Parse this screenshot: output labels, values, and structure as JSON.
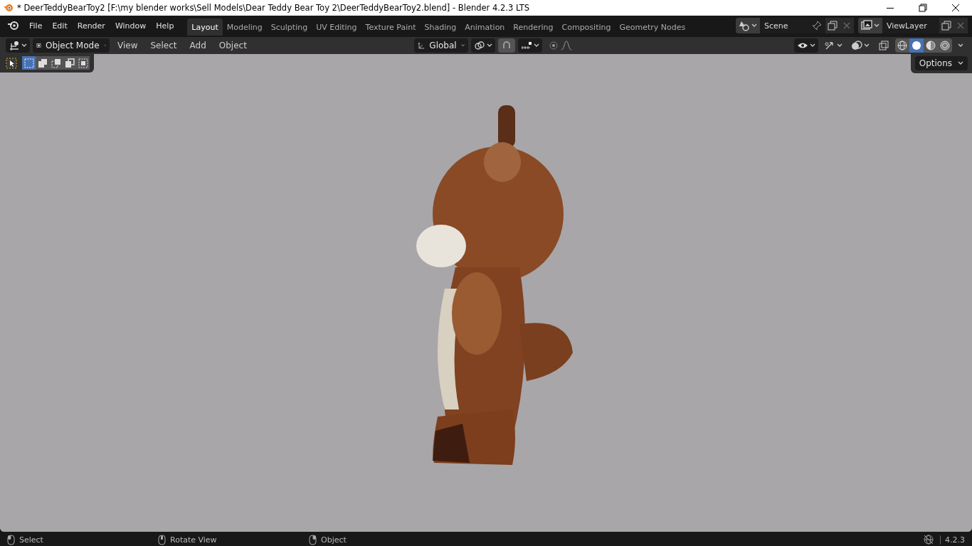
{
  "window": {
    "title": "* DeerTeddyBearToy2 [F:\\my blender works\\Sell Models\\Dear Teddy Bear Toy 2\\DeerTeddyBearToy2.blend] - Blender 4.2.3 LTS"
  },
  "menu": [
    "File",
    "Edit",
    "Render",
    "Window",
    "Help"
  ],
  "workspaces": [
    {
      "label": "Layout",
      "selected": true
    },
    {
      "label": "Modeling",
      "selected": false
    },
    {
      "label": "Sculpting",
      "selected": false
    },
    {
      "label": "UV Editing",
      "selected": false
    },
    {
      "label": "Texture Paint",
      "selected": false
    },
    {
      "label": "Shading",
      "selected": false
    },
    {
      "label": "Animation",
      "selected": false
    },
    {
      "label": "Rendering",
      "selected": false
    },
    {
      "label": "Compositing",
      "selected": false
    },
    {
      "label": "Geometry Nodes",
      "selected": false
    }
  ],
  "scene": {
    "value": "Scene"
  },
  "view_layer": {
    "value": "ViewLayer"
  },
  "header": {
    "mode": "Object Mode",
    "menus": [
      "View",
      "Select",
      "Add",
      "Object"
    ],
    "orientation": "Global",
    "shading_modes": [
      {
        "selected": false
      },
      {
        "selected": true
      },
      {
        "selected": false
      },
      {
        "selected": false
      }
    ]
  },
  "viewport": {
    "select_modes": [
      {
        "selected": true
      },
      {
        "selected": false
      },
      {
        "selected": false
      },
      {
        "selected": false
      },
      {
        "selected": false
      }
    ],
    "options": "Options"
  },
  "status_bar": {
    "items": [
      {
        "label": "Select"
      },
      {
        "label": "Rotate View"
      },
      {
        "label": "Object"
      }
    ],
    "version": "4.2.3"
  }
}
